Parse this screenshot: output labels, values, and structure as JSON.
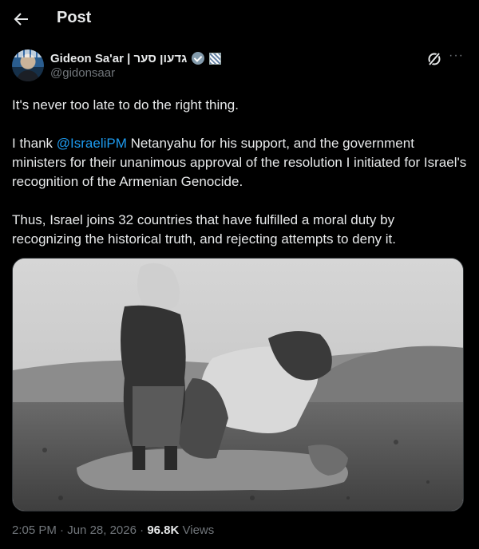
{
  "header": {
    "back_icon": "arrow-left-icon",
    "title": "Post"
  },
  "author": {
    "display_name": "Gideon Sa'ar | גדעון סער",
    "handle": "@gidonsaar",
    "verified_badge_color": "#829aab"
  },
  "actions": {
    "grok_icon": "grok-icon",
    "more_icon": "more-icon",
    "more_glyph": "···"
  },
  "tweet": {
    "line1": "It's never too late to do the right thing.",
    "p2_before": "I thank ",
    "mention": "@IsraeliPM",
    "p2_after": " Netanyahu for his support, and the government ministers for their unanimous approval of the resolution I initiated for Israel's recognition of the Armenian Genocide.",
    "p3": "Thus, Israel joins 32 countries that have fulfilled a moral duty by recognizing the historical truth, and rejecting attempts to deny it."
  },
  "media": {
    "kind": "black-and-white photograph"
  },
  "meta": {
    "time": "2:05 PM",
    "sep1": " · ",
    "date": "Jun 28, 2026",
    "sep2": " · ",
    "views_count": "96.8K",
    "views_label": " Views"
  },
  "colors": {
    "background": "#000000",
    "text": "#e7e9ea",
    "secondary": "#71767b",
    "link": "#1d9bf0"
  }
}
